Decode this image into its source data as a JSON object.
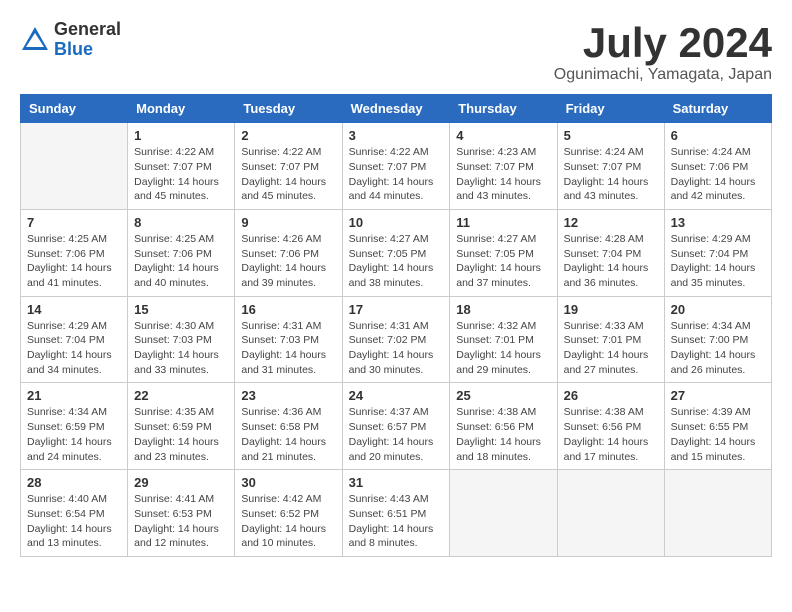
{
  "header": {
    "logo": {
      "general": "General",
      "blue": "Blue"
    },
    "title": "July 2024",
    "location": "Ogunimachi, Yamagata, Japan"
  },
  "days_of_week": [
    "Sunday",
    "Monday",
    "Tuesday",
    "Wednesday",
    "Thursday",
    "Friday",
    "Saturday"
  ],
  "weeks": [
    [
      {
        "num": "",
        "empty": true
      },
      {
        "num": "1",
        "rise": "4:22 AM",
        "set": "7:07 PM",
        "daylight": "14 hours and 45 minutes."
      },
      {
        "num": "2",
        "rise": "4:22 AM",
        "set": "7:07 PM",
        "daylight": "14 hours and 45 minutes."
      },
      {
        "num": "3",
        "rise": "4:22 AM",
        "set": "7:07 PM",
        "daylight": "14 hours and 44 minutes."
      },
      {
        "num": "4",
        "rise": "4:23 AM",
        "set": "7:07 PM",
        "daylight": "14 hours and 43 minutes."
      },
      {
        "num": "5",
        "rise": "4:24 AM",
        "set": "7:07 PM",
        "daylight": "14 hours and 43 minutes."
      },
      {
        "num": "6",
        "rise": "4:24 AM",
        "set": "7:06 PM",
        "daylight": "14 hours and 42 minutes."
      }
    ],
    [
      {
        "num": "7",
        "rise": "4:25 AM",
        "set": "7:06 PM",
        "daylight": "14 hours and 41 minutes."
      },
      {
        "num": "8",
        "rise": "4:25 AM",
        "set": "7:06 PM",
        "daylight": "14 hours and 40 minutes."
      },
      {
        "num": "9",
        "rise": "4:26 AM",
        "set": "7:06 PM",
        "daylight": "14 hours and 39 minutes."
      },
      {
        "num": "10",
        "rise": "4:27 AM",
        "set": "7:05 PM",
        "daylight": "14 hours and 38 minutes."
      },
      {
        "num": "11",
        "rise": "4:27 AM",
        "set": "7:05 PM",
        "daylight": "14 hours and 37 minutes."
      },
      {
        "num": "12",
        "rise": "4:28 AM",
        "set": "7:04 PM",
        "daylight": "14 hours and 36 minutes."
      },
      {
        "num": "13",
        "rise": "4:29 AM",
        "set": "7:04 PM",
        "daylight": "14 hours and 35 minutes."
      }
    ],
    [
      {
        "num": "14",
        "rise": "4:29 AM",
        "set": "7:04 PM",
        "daylight": "14 hours and 34 minutes."
      },
      {
        "num": "15",
        "rise": "4:30 AM",
        "set": "7:03 PM",
        "daylight": "14 hours and 33 minutes."
      },
      {
        "num": "16",
        "rise": "4:31 AM",
        "set": "7:03 PM",
        "daylight": "14 hours and 31 minutes."
      },
      {
        "num": "17",
        "rise": "4:31 AM",
        "set": "7:02 PM",
        "daylight": "14 hours and 30 minutes."
      },
      {
        "num": "18",
        "rise": "4:32 AM",
        "set": "7:01 PM",
        "daylight": "14 hours and 29 minutes."
      },
      {
        "num": "19",
        "rise": "4:33 AM",
        "set": "7:01 PM",
        "daylight": "14 hours and 27 minutes."
      },
      {
        "num": "20",
        "rise": "4:34 AM",
        "set": "7:00 PM",
        "daylight": "14 hours and 26 minutes."
      }
    ],
    [
      {
        "num": "21",
        "rise": "4:34 AM",
        "set": "6:59 PM",
        "daylight": "14 hours and 24 minutes."
      },
      {
        "num": "22",
        "rise": "4:35 AM",
        "set": "6:59 PM",
        "daylight": "14 hours and 23 minutes."
      },
      {
        "num": "23",
        "rise": "4:36 AM",
        "set": "6:58 PM",
        "daylight": "14 hours and 21 minutes."
      },
      {
        "num": "24",
        "rise": "4:37 AM",
        "set": "6:57 PM",
        "daylight": "14 hours and 20 minutes."
      },
      {
        "num": "25",
        "rise": "4:38 AM",
        "set": "6:56 PM",
        "daylight": "14 hours and 18 minutes."
      },
      {
        "num": "26",
        "rise": "4:38 AM",
        "set": "6:56 PM",
        "daylight": "14 hours and 17 minutes."
      },
      {
        "num": "27",
        "rise": "4:39 AM",
        "set": "6:55 PM",
        "daylight": "14 hours and 15 minutes."
      }
    ],
    [
      {
        "num": "28",
        "rise": "4:40 AM",
        "set": "6:54 PM",
        "daylight": "14 hours and 13 minutes."
      },
      {
        "num": "29",
        "rise": "4:41 AM",
        "set": "6:53 PM",
        "daylight": "14 hours and 12 minutes."
      },
      {
        "num": "30",
        "rise": "4:42 AM",
        "set": "6:52 PM",
        "daylight": "14 hours and 10 minutes."
      },
      {
        "num": "31",
        "rise": "4:43 AM",
        "set": "6:51 PM",
        "daylight": "14 hours and 8 minutes."
      },
      {
        "num": "",
        "empty": true
      },
      {
        "num": "",
        "empty": true
      },
      {
        "num": "",
        "empty": true
      }
    ]
  ]
}
